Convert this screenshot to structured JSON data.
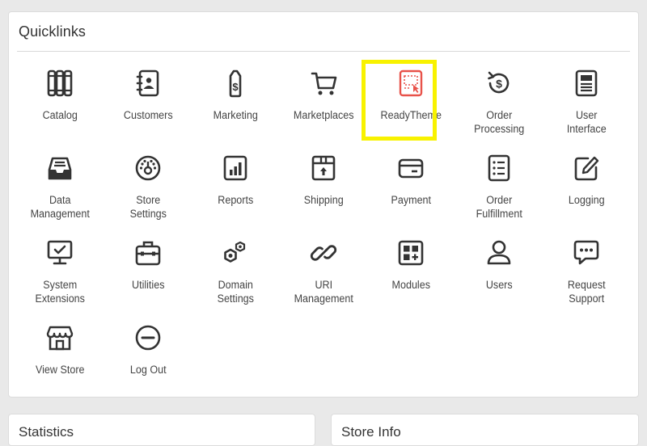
{
  "quicklinks": {
    "title": "Quicklinks",
    "items": [
      {
        "label": "Catalog",
        "icon": "catalog-icon"
      },
      {
        "label": "Customers",
        "icon": "customers-icon"
      },
      {
        "label": "Marketing",
        "icon": "marketing-tag-icon"
      },
      {
        "label": "Marketplaces",
        "icon": "cart-icon"
      },
      {
        "label": "ReadyTheme",
        "icon": "readytheme-icon",
        "highlighted": true
      },
      {
        "label": "Order\nProcessing",
        "icon": "order-processing-icon"
      },
      {
        "label": "User\nInterface",
        "icon": "user-interface-icon"
      },
      {
        "label": "Data\nManagement",
        "icon": "data-management-icon"
      },
      {
        "label": "Store\nSettings",
        "icon": "store-settings-icon"
      },
      {
        "label": "Reports",
        "icon": "reports-icon"
      },
      {
        "label": "Shipping",
        "icon": "shipping-icon"
      },
      {
        "label": "Payment",
        "icon": "payment-icon"
      },
      {
        "label": "Order\nFulfillment",
        "icon": "order-fulfillment-icon"
      },
      {
        "label": "Logging",
        "icon": "logging-icon"
      },
      {
        "label": "System\nExtensions",
        "icon": "system-extensions-icon"
      },
      {
        "label": "Utilities",
        "icon": "utilities-icon"
      },
      {
        "label": "Domain\nSettings",
        "icon": "domain-settings-icon"
      },
      {
        "label": "URI\nManagement",
        "icon": "uri-management-icon"
      },
      {
        "label": "Modules",
        "icon": "modules-icon"
      },
      {
        "label": "Users",
        "icon": "users-icon"
      },
      {
        "label": "Request\nSupport",
        "icon": "request-support-icon"
      },
      {
        "label": "View Store",
        "icon": "view-store-icon"
      },
      {
        "label": "Log Out",
        "icon": "log-out-icon"
      }
    ]
  },
  "bottom_cards": {
    "left_title": "Statistics",
    "right_title": "Store Info"
  },
  "colors": {
    "icon": "#333333",
    "accent": "#e8524a",
    "highlight": "#f8f200"
  }
}
